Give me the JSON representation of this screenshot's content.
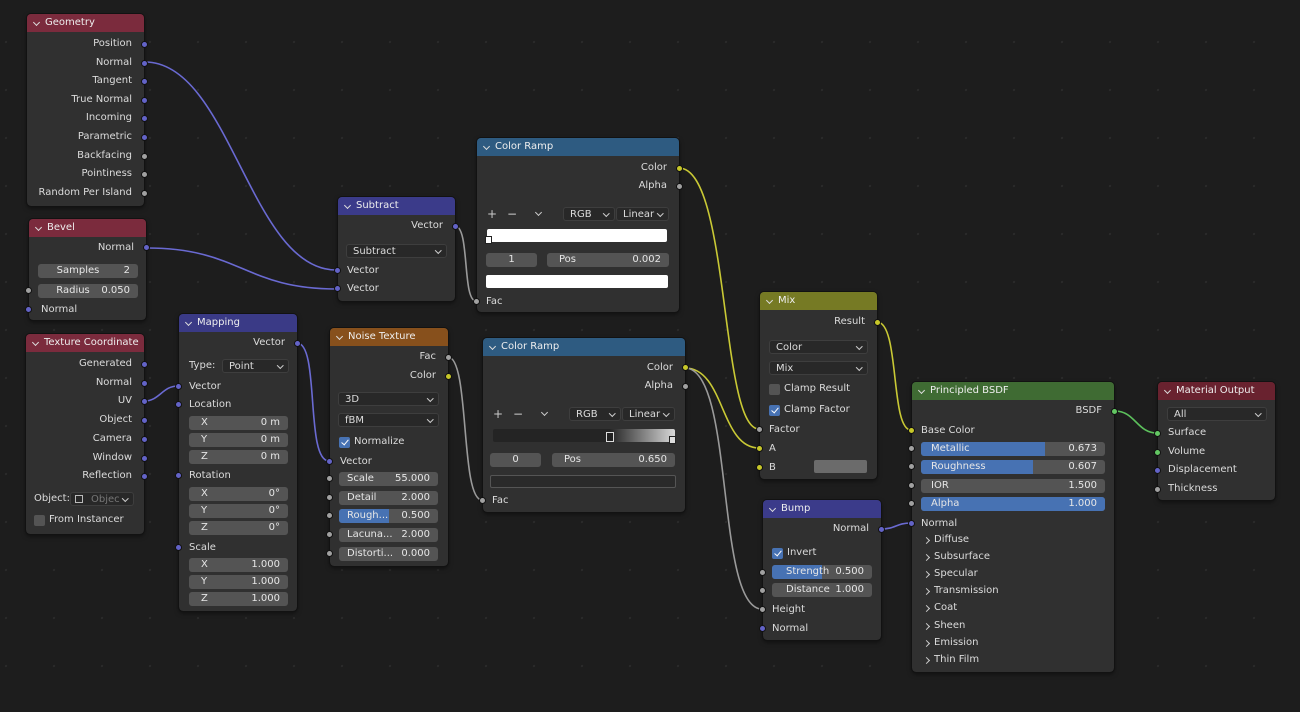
{
  "nodes": {
    "geometry": {
      "title": "Geometry",
      "outputs": [
        "Position",
        "Normal",
        "Tangent",
        "True Normal",
        "Incoming",
        "Parametric",
        "Backfacing",
        "Pointiness",
        "Random Per Island"
      ]
    },
    "bevel": {
      "title": "Bevel",
      "output": "Normal",
      "samples_label": "Samples",
      "samples_value": "2",
      "radius_label": "Radius",
      "radius_value": "0.050",
      "input": "Normal"
    },
    "texcoord": {
      "title": "Texture Coordinate",
      "outputs": [
        "Generated",
        "Normal",
        "UV",
        "Object",
        "Camera",
        "Window",
        "Reflection"
      ],
      "object_label": "Object:",
      "object_placeholder": "Objec",
      "from_instancer": "From Instancer"
    },
    "mapping": {
      "title": "Mapping",
      "output": "Vector",
      "type_label": "Type:",
      "type_value": "Point",
      "vector": "Vector",
      "location": "Location",
      "loc": [
        {
          "k": "X",
          "v": "0 m"
        },
        {
          "k": "Y",
          "v": "0 m"
        },
        {
          "k": "Z",
          "v": "0 m"
        }
      ],
      "rotation": "Rotation",
      "rot": [
        {
          "k": "X",
          "v": "0°"
        },
        {
          "k": "Y",
          "v": "0°"
        },
        {
          "k": "Z",
          "v": "0°"
        }
      ],
      "scale": "Scale",
      "scl": [
        {
          "k": "X",
          "v": "1.000"
        },
        {
          "k": "Y",
          "v": "1.000"
        },
        {
          "k": "Z",
          "v": "1.000"
        }
      ]
    },
    "subtract": {
      "title": "Subtract",
      "output": "Vector",
      "op": "Subtract",
      "in1": "Vector",
      "in2": "Vector"
    },
    "noise": {
      "title": "Noise Texture",
      "out_fac": "Fac",
      "out_color": "Color",
      "dim": "3D",
      "type": "fBM",
      "normalize": "Normalize",
      "vector": "Vector",
      "params": [
        {
          "k": "Scale",
          "v": "55.000"
        },
        {
          "k": "Detail",
          "v": "2.000"
        },
        {
          "k": "Rough...",
          "v": "0.500",
          "fill": 0.5
        },
        {
          "k": "Lacuna...",
          "v": "2.000"
        },
        {
          "k": "Distorti...",
          "v": "0.000"
        }
      ]
    },
    "ramp1": {
      "title": "Color Ramp",
      "out_color": "Color",
      "out_alpha": "Alpha",
      "mode": "RGB",
      "interp": "Linear",
      "index": "1",
      "pos_label": "Pos",
      "pos_value": "0.002",
      "fac": "Fac"
    },
    "ramp2": {
      "title": "Color Ramp",
      "out_color": "Color",
      "out_alpha": "Alpha",
      "mode": "RGB",
      "interp": "Linear",
      "index": "0",
      "pos_label": "Pos",
      "pos_value": "0.650",
      "fac": "Fac"
    },
    "mix": {
      "title": "Mix",
      "output": "Result",
      "data_type": "Color",
      "blend": "Mix",
      "clamp_result": "Clamp Result",
      "clamp_factor": "Clamp Factor",
      "factor": "Factor",
      "a": "A",
      "b": "B"
    },
    "bump": {
      "title": "Bump",
      "output": "Normal",
      "invert": "Invert",
      "strength_label": "Strength",
      "strength_value": "0.500",
      "distance_label": "Distance",
      "distance_value": "1.000",
      "height": "Height",
      "normal": "Normal"
    },
    "bsdf": {
      "title": "Principled BSDF",
      "output": "BSDF",
      "base_color": "Base Color",
      "params": [
        {
          "k": "Metallic",
          "v": "0.673",
          "fill": 0.673
        },
        {
          "k": "Roughness",
          "v": "0.607",
          "fill": 0.607
        },
        {
          "k": "IOR",
          "v": "1.500",
          "fill": 0
        },
        {
          "k": "Alpha",
          "v": "1.000",
          "fill": 1
        }
      ],
      "normal": "Normal",
      "panels": [
        "Diffuse",
        "Subsurface",
        "Specular",
        "Transmission",
        "Coat",
        "Sheen",
        "Emission",
        "Thin Film"
      ]
    },
    "output": {
      "title": "Material Output",
      "target": "All",
      "inputs": [
        "Surface",
        "Volume",
        "Displacement",
        "Thickness"
      ]
    }
  },
  "colors": {
    "vector_socket": "#6363c7",
    "gray_socket": "#a1a1a1",
    "color_socket": "#c7c729",
    "shader_socket": "#63c763",
    "slider_fill": "#4772b3"
  }
}
